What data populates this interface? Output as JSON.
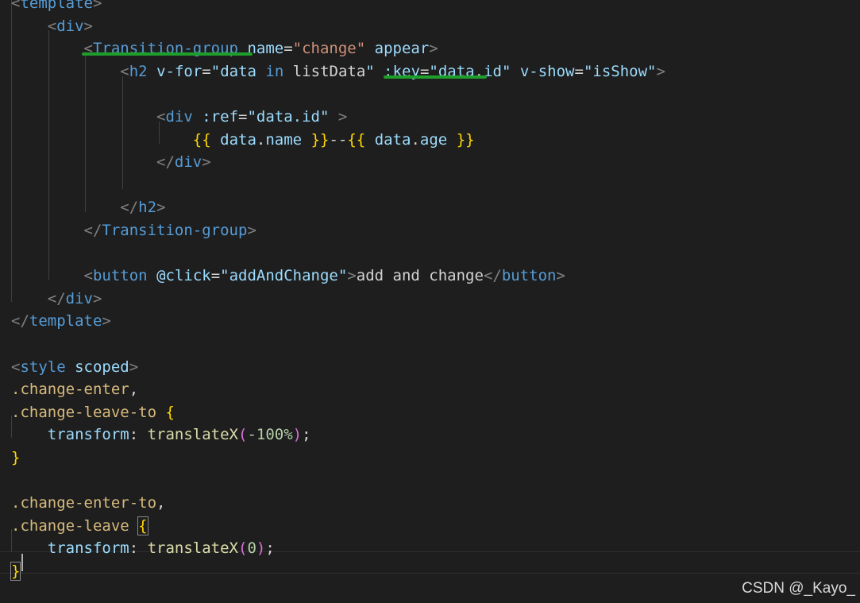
{
  "editor": {
    "lines": [
      {
        "tokens": [
          {
            "t": "<",
            "c": "punc"
          },
          {
            "t": "template",
            "c": "tag"
          },
          {
            "t": ">",
            "c": "punc"
          }
        ]
      },
      {
        "tokens": [
          {
            "t": "    "
          },
          {
            "t": "<",
            "c": "punc"
          },
          {
            "t": "div",
            "c": "tag"
          },
          {
            "t": ">",
            "c": "punc"
          }
        ]
      },
      {
        "tokens": [
          {
            "t": "        "
          },
          {
            "t": "<",
            "c": "punc"
          },
          {
            "t": "Transition-group",
            "c": "tag"
          },
          {
            "t": " "
          },
          {
            "t": "name",
            "c": "attr"
          },
          {
            "t": "=",
            "c": "plain"
          },
          {
            "t": "\"change\"",
            "c": "str"
          },
          {
            "t": " "
          },
          {
            "t": "appear",
            "c": "attr"
          },
          {
            "t": ">",
            "c": "punc"
          }
        ]
      },
      {
        "tokens": [
          {
            "t": "            "
          },
          {
            "t": "<",
            "c": "punc"
          },
          {
            "t": "h2",
            "c": "tag"
          },
          {
            "t": " "
          },
          {
            "t": "v-for",
            "c": "attr"
          },
          {
            "t": "=",
            "c": "plain"
          },
          {
            "t": "\"",
            "c": "attr"
          },
          {
            "t": "data",
            "c": "attr"
          },
          {
            "t": " "
          },
          {
            "t": "in",
            "c": "tag"
          },
          {
            "t": " "
          },
          {
            "t": "listData",
            "c": "plain"
          },
          {
            "t": "\"",
            "c": "attr"
          },
          {
            "t": " "
          },
          {
            "t": ":key",
            "c": "attr"
          },
          {
            "t": "=",
            "c": "plain"
          },
          {
            "t": "\"",
            "c": "attr"
          },
          {
            "t": "data",
            "c": "attr"
          },
          {
            "t": ".",
            "c": "plain"
          },
          {
            "t": "id",
            "c": "attr"
          },
          {
            "t": "\"",
            "c": "attr"
          },
          {
            "t": " "
          },
          {
            "t": "v-show",
            "c": "attr"
          },
          {
            "t": "=",
            "c": "plain"
          },
          {
            "t": "\"isShow\"",
            "c": "attr"
          },
          {
            "t": ">",
            "c": "punc"
          }
        ]
      },
      {
        "tokens": []
      },
      {
        "tokens": [
          {
            "t": "                "
          },
          {
            "t": "<",
            "c": "punc"
          },
          {
            "t": "div",
            "c": "tag"
          },
          {
            "t": " "
          },
          {
            "t": ":ref",
            "c": "attr"
          },
          {
            "t": "=",
            "c": "plain"
          },
          {
            "t": "\"data.id\"",
            "c": "attr"
          },
          {
            "t": " "
          },
          {
            "t": ">",
            "c": "punc"
          }
        ]
      },
      {
        "tokens": [
          {
            "t": "                    "
          },
          {
            "t": "{{",
            "c": "brace"
          },
          {
            "t": " "
          },
          {
            "t": "data",
            "c": "var"
          },
          {
            "t": ".",
            "c": "plain"
          },
          {
            "t": "name",
            "c": "var"
          },
          {
            "t": " "
          },
          {
            "t": "}}",
            "c": "brace"
          },
          {
            "t": "--",
            "c": "plain"
          },
          {
            "t": "{{",
            "c": "brace"
          },
          {
            "t": " "
          },
          {
            "t": "data",
            "c": "var"
          },
          {
            "t": ".",
            "c": "plain"
          },
          {
            "t": "age",
            "c": "var"
          },
          {
            "t": " "
          },
          {
            "t": "}}",
            "c": "brace"
          }
        ]
      },
      {
        "tokens": [
          {
            "t": "                "
          },
          {
            "t": "</",
            "c": "punc"
          },
          {
            "t": "div",
            "c": "tag"
          },
          {
            "t": ">",
            "c": "punc"
          }
        ]
      },
      {
        "tokens": []
      },
      {
        "tokens": [
          {
            "t": "            "
          },
          {
            "t": "</",
            "c": "punc"
          },
          {
            "t": "h2",
            "c": "tag"
          },
          {
            "t": ">",
            "c": "punc"
          }
        ]
      },
      {
        "tokens": [
          {
            "t": "        "
          },
          {
            "t": "</",
            "c": "punc"
          },
          {
            "t": "Transition-group",
            "c": "tag"
          },
          {
            "t": ">",
            "c": "punc"
          }
        ]
      },
      {
        "tokens": []
      },
      {
        "tokens": [
          {
            "t": "        "
          },
          {
            "t": "<",
            "c": "punc"
          },
          {
            "t": "button",
            "c": "tag"
          },
          {
            "t": " "
          },
          {
            "t": "@click",
            "c": "attr"
          },
          {
            "t": "=",
            "c": "plain"
          },
          {
            "t": "\"addAndChange\"",
            "c": "attr"
          },
          {
            "t": ">",
            "c": "punc"
          },
          {
            "t": "add and change",
            "c": "plain"
          },
          {
            "t": "</",
            "c": "punc"
          },
          {
            "t": "button",
            "c": "tag"
          },
          {
            "t": ">",
            "c": "punc"
          }
        ]
      },
      {
        "tokens": [
          {
            "t": "    "
          },
          {
            "t": "</",
            "c": "punc"
          },
          {
            "t": "div",
            "c": "tag"
          },
          {
            "t": ">",
            "c": "punc"
          }
        ]
      },
      {
        "tokens": [
          {
            "t": "</",
            "c": "punc"
          },
          {
            "t": "template",
            "c": "tag"
          },
          {
            "t": ">",
            "c": "punc"
          }
        ]
      },
      {
        "tokens": []
      },
      {
        "tokens": [
          {
            "t": "<",
            "c": "punc"
          },
          {
            "t": "style",
            "c": "tag"
          },
          {
            "t": " "
          },
          {
            "t": "scoped",
            "c": "attr"
          },
          {
            "t": ">",
            "c": "punc"
          }
        ]
      },
      {
        "tokens": [
          {
            "t": ".change-enter",
            "c": "sel"
          },
          {
            "t": ",",
            "c": "plain"
          }
        ]
      },
      {
        "tokens": [
          {
            "t": ".change-leave-to",
            "c": "sel"
          },
          {
            "t": " "
          },
          {
            "t": "{",
            "c": "brace"
          }
        ]
      },
      {
        "tokens": [
          {
            "t": "    "
          },
          {
            "t": "transform",
            "c": "prop"
          },
          {
            "t": ": ",
            "c": "plain"
          },
          {
            "t": "translateX",
            "c": "fn"
          },
          {
            "t": "(",
            "c": "paren"
          },
          {
            "t": "-100%",
            "c": "num"
          },
          {
            "t": ")",
            "c": "paren"
          },
          {
            "t": ";",
            "c": "plain"
          }
        ]
      },
      {
        "tokens": [
          {
            "t": "}",
            "c": "brace"
          }
        ]
      },
      {
        "tokens": []
      },
      {
        "tokens": [
          {
            "t": ".change-enter-to",
            "c": "sel"
          },
          {
            "t": ",",
            "c": "plain"
          }
        ]
      },
      {
        "tokens": [
          {
            "t": ".change-leave",
            "c": "sel"
          },
          {
            "t": " "
          },
          {
            "t": "{",
            "c": "brace",
            "m": true
          }
        ]
      },
      {
        "tokens": [
          {
            "t": "    "
          },
          {
            "t": "transform",
            "c": "prop"
          },
          {
            "t": ": ",
            "c": "plain"
          },
          {
            "t": "translateX",
            "c": "fn"
          },
          {
            "t": "(",
            "c": "paren"
          },
          {
            "t": "0",
            "c": "num"
          },
          {
            "t": ")",
            "c": "paren"
          },
          {
            "t": ";",
            "c": "plain"
          }
        ]
      },
      {
        "tokens": [
          {
            "t": "}",
            "c": "brace",
            "m": true
          }
        ]
      }
    ]
  },
  "watermark": "CSDN @_Kayo_",
  "colors": {
    "background": "#1e1e1e",
    "tag": "#569cd6",
    "attribute": "#9cdcfe",
    "string": "#ce9178",
    "selector": "#d7ba7d",
    "bracket_gold": "#ffd700",
    "bracket_pink": "#da70d6",
    "annotation_underline": "#1e9e2a"
  }
}
